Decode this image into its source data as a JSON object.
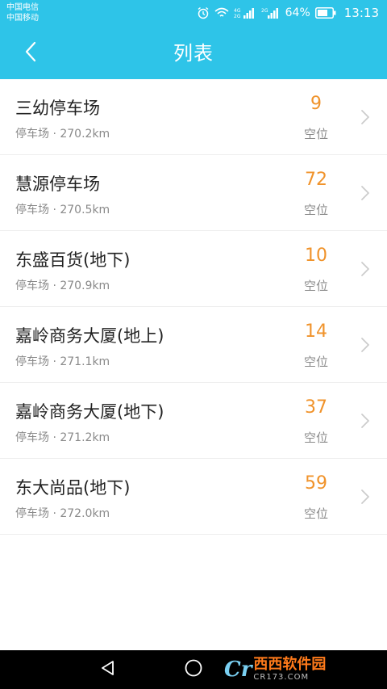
{
  "status_bar": {
    "carrier_1": "中国电信",
    "carrier_2": "中国移动",
    "battery": "64%",
    "time": "13:13",
    "icons": [
      "alarm-icon",
      "wifi-icon",
      "signal-4g-icon",
      "signal-2g-icon",
      "battery-icon"
    ]
  },
  "header": {
    "title": "列表",
    "back_icon": "chevron-left-icon",
    "background": "#2ec4e8"
  },
  "list": {
    "items": [
      {
        "name": "三幼停车场",
        "type": "停车场",
        "distance": "270.2km",
        "count": "9",
        "count_label": "空位"
      },
      {
        "name": "慧源停车场",
        "type": "停车场",
        "distance": "270.5km",
        "count": "72",
        "count_label": "空位"
      },
      {
        "name": "东盛百货(地下)",
        "type": "停车场",
        "distance": "270.9km",
        "count": "10",
        "count_label": "空位"
      },
      {
        "name": "嘉岭商务大厦(地上)",
        "type": "停车场",
        "distance": "271.1km",
        "count": "14",
        "count_label": "空位"
      },
      {
        "name": "嘉岭商务大厦(地下)",
        "type": "停车场",
        "distance": "271.2km",
        "count": "37",
        "count_label": "空位"
      },
      {
        "name": "东大尚品(地下)",
        "type": "停车场",
        "distance": "272.0km",
        "count": "59",
        "count_label": "空位"
      }
    ],
    "separator": "·",
    "count_color": "#f0932b"
  },
  "nav_bar": {
    "icons": [
      "back-triangle-icon",
      "home-circle-icon"
    ]
  },
  "watermark": {
    "main": "西西软件园",
    "sub": "CR173.COM"
  }
}
